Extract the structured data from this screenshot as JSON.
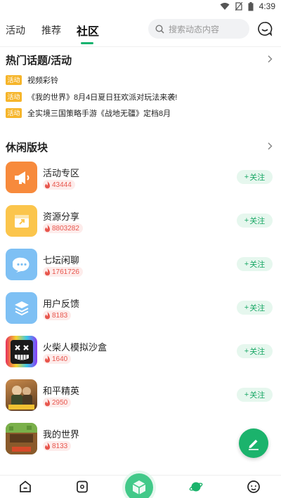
{
  "status": {
    "time": "4:39",
    "wifi_icon": "wifi-icon",
    "sim_icon": "no-sim-icon",
    "battery_icon": "battery-icon"
  },
  "nav": {
    "tabs": [
      {
        "label": "活动"
      },
      {
        "label": "推荐"
      },
      {
        "label": "社区"
      }
    ],
    "active_tab": "社区",
    "search_placeholder": "搜索动态内容",
    "accent": "#17b36f"
  },
  "hot_topics": {
    "title": "热门话题/活动",
    "badge": "活动",
    "badge_color": "#f6b52a",
    "items": [
      {
        "text": "视频彩铃"
      },
      {
        "text": "《我的世界》8月4日夏日狂欢派对玩法来袭!"
      },
      {
        "text": "全实境三国策略手游《战地无疆》定档8月"
      }
    ]
  },
  "boards": {
    "title": "休闲版块",
    "follow_label": "关注",
    "items": [
      {
        "name": "活动专区",
        "count": "43444",
        "icon": "megaphone-icon",
        "color": "#f78a3c"
      },
      {
        "name": "资源分享",
        "count": "8803282",
        "icon": "share-box-icon",
        "color": "#fbc54c"
      },
      {
        "name": "七坛闲聊",
        "count": "1761726",
        "icon": "chat-bubble-icon",
        "color": "#7ec0f4"
      },
      {
        "name": "用户反馈",
        "count": "8183",
        "icon": "layers-icon",
        "color": "#7ec0f4"
      },
      {
        "name": "火柴人模拟沙盒",
        "count": "1640",
        "icon": "stickman-game-icon",
        "color": "#222222"
      },
      {
        "name": "和平精英",
        "count": "2950",
        "icon": "peace-elite-game-icon",
        "color": "#8a5a2b"
      },
      {
        "name": "我的世界",
        "count": "8133",
        "icon": "minecraft-game-icon",
        "color": "#6a8a3c"
      }
    ]
  },
  "bottom_nav": {
    "items": [
      {
        "icon": "home-icon"
      },
      {
        "icon": "gamepad-icon"
      },
      {
        "icon": "cube-icon"
      },
      {
        "icon": "planet-icon"
      },
      {
        "icon": "profile-icon"
      }
    ]
  }
}
